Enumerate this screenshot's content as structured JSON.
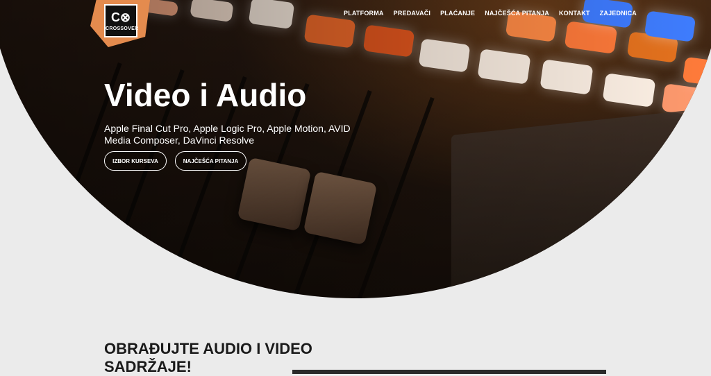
{
  "brand": {
    "logo_mark": "C⊗",
    "logo_text": "CROSSOVER",
    "accent_color": "#e48b4e"
  },
  "nav": {
    "items": [
      "PLATFORMA",
      "PREDAVAČI",
      "PLAĆANJE",
      "NAJČEŠĆA PITANJA",
      "KONTAKT",
      "ZAJEDNICA"
    ]
  },
  "hero": {
    "title": "Video i Audio",
    "subtitle": "Apple Final Cut Pro, Apple Logic Pro, Apple Motion, AVID Media Composer, DaVinci Resolve",
    "buttons": [
      "IZBOR KURSEVA",
      "NAJČEŠĆA PITANJA"
    ]
  },
  "section": {
    "heading": "OBRAĐUJTE AUDIO I VIDEO SADRŽAJE!"
  }
}
